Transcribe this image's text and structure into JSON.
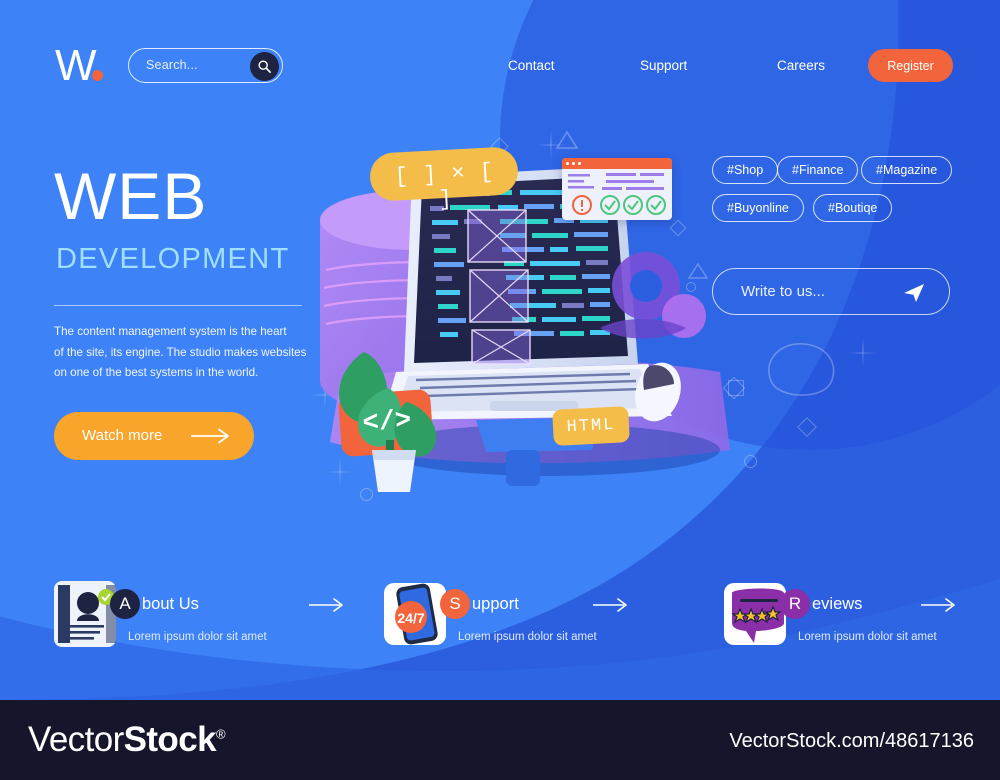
{
  "brand": {
    "logo_text": "W",
    "logo_dot": "dot"
  },
  "search": {
    "placeholder": "Search...",
    "icon": "search-icon"
  },
  "nav": {
    "items": [
      {
        "label": "Contact"
      },
      {
        "label": "Support"
      },
      {
        "label": "Careers"
      }
    ],
    "register_label": "Register"
  },
  "hero": {
    "title": "WEB",
    "subtitle": "DEVELOPMENT",
    "paragraph": "The content management system is the heart of the site, its engine. The studio makes websites on one of the best systems in the world.",
    "paragraph_lines": [
      "The content management system is the heart",
      "of the site, its engine. The studio makes websites",
      "on one of the best systems in the world."
    ],
    "cta_label": "Watch more",
    "cta_icon": "arrow-right-icon"
  },
  "tags": [
    {
      "label": "#Shop"
    },
    {
      "label": "#Finance"
    },
    {
      "label": "#Magazine"
    },
    {
      "label": "#Buyonline"
    },
    {
      "label": "#Boutiqe"
    }
  ],
  "write_to_us": {
    "placeholder": "Write to us...",
    "icon": "send-icon"
  },
  "illustration": {
    "badge_brackets": "[ ]  ×  [ ]",
    "badge_code": "</>",
    "badge_html": "HTML",
    "browser_alert_icon": "alert-circle-icon",
    "browser_check_icon": "check-circle-icon",
    "browser_check_count": 3
  },
  "features": [
    {
      "initial": "A",
      "rest": "bout Us",
      "subtitle": "Lorem ipsum dolor sit amet",
      "badge_color": "#1d2340",
      "thumb": "document-profile-icon",
      "arrow": "arrow-right-icon"
    },
    {
      "initial": "S",
      "rest": "upport",
      "subtitle": "Lorem ipsum dolor sit amet",
      "badge_color": "#f2643c",
      "thumb": "phone-247-icon",
      "thumb_text": "24/7",
      "arrow": "arrow-right-icon"
    },
    {
      "initial": "R",
      "rest": "eviews",
      "subtitle": "Lorem ipsum dolor sit amet",
      "badge_color": "#8a2fa8",
      "thumb": "speech-bubble-stars-icon",
      "arrow": "arrow-right-icon"
    }
  ],
  "footer": {
    "wordmark_light": "Vector",
    "wordmark_bold": "Stock",
    "registered": "®",
    "url": "VectorStock.com/48617136"
  },
  "colors": {
    "bg_dark_blue": "#2b5fe0",
    "bg_light_blue": "#3d82f6",
    "accent_orange": "#f2643c",
    "cta_yellow": "#f9a42b",
    "subtitle_cyan": "#9fe0ff",
    "footer_bg": "#15162b"
  }
}
